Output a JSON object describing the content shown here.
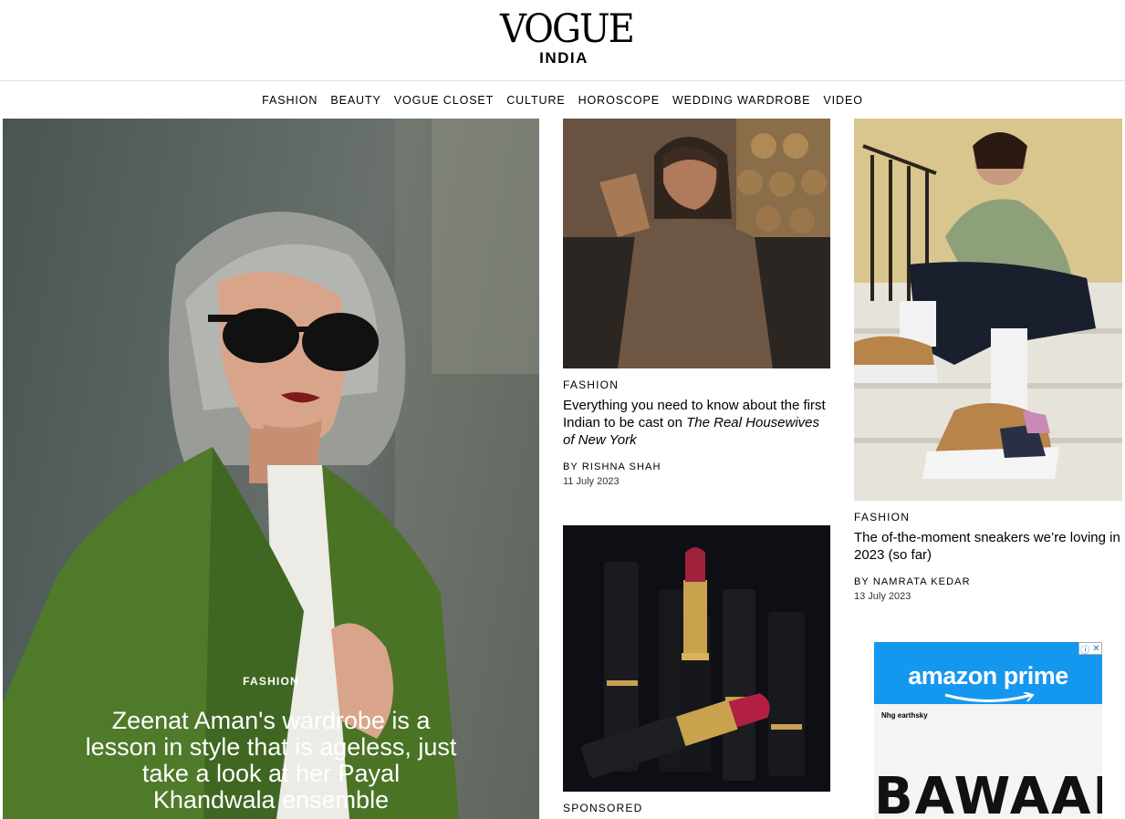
{
  "header": {
    "logo_main": "VOGUE",
    "logo_sub": "INDIA"
  },
  "nav": {
    "items": [
      "FASHION",
      "BEAUTY",
      "VOGUE CLOSET",
      "CULTURE",
      "HOROSCOPE",
      "WEDDING WARDROBE",
      "VIDEO"
    ]
  },
  "hero": {
    "category": "FASHION",
    "title": "Zeenat Aman's wardrobe is a lesson in style that is ageless, just take a look at her Payal Khandwala ensemble"
  },
  "cards": [
    {
      "category": "FASHION",
      "title_prefix": "Everything you need to know about the first Indian to be cast on ",
      "title_italic": "The Real Housewives of New York",
      "byline": "BY RISHNA SHAH",
      "date": "11 July 2023"
    },
    {
      "category": "FASHION",
      "title": "The of-the-moment sneakers we’re loving in 2023 (so far)",
      "byline": "BY NAMRATA KEDAR",
      "date": "13 July 2023"
    },
    {
      "category": "SPONSORED"
    }
  ],
  "ad": {
    "brand": "amazon prime",
    "sponsors": "Nhg earthsky",
    "movie_title": "BAWAAL",
    "choices_icons": [
      "adchoices-icon",
      "close-icon"
    ]
  }
}
